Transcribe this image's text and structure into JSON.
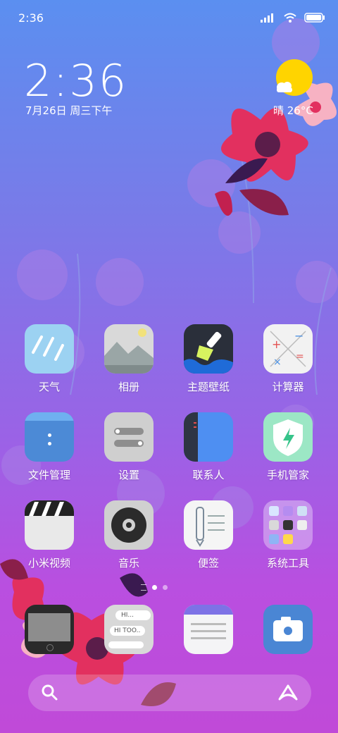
{
  "status_bar": {
    "time": "2:36"
  },
  "clock": {
    "time": "2:36",
    "date": "7月26日 周三下午"
  },
  "weather": {
    "text": "晴 26°C"
  },
  "apps_row1": [
    {
      "label": "天气",
      "icon": "weather-rain-icon"
    },
    {
      "label": "相册",
      "icon": "gallery-icon"
    },
    {
      "label": "主题壁纸",
      "icon": "theme-brush-icon"
    },
    {
      "label": "计算器",
      "icon": "calculator-icon"
    }
  ],
  "apps_row2": [
    {
      "label": "文件管理",
      "icon": "folder-icon"
    },
    {
      "label": "设置",
      "icon": "settings-toggle-icon"
    },
    {
      "label": "联系人",
      "icon": "contacts-book-icon"
    },
    {
      "label": "手机管家",
      "icon": "security-shield-icon"
    }
  ],
  "apps_row3": [
    {
      "label": "小米视频",
      "icon": "video-clapper-icon"
    },
    {
      "label": "音乐",
      "icon": "music-disc-icon"
    },
    {
      "label": "便签",
      "icon": "notes-pen-icon"
    },
    {
      "label": "系统工具",
      "icon": "folder-system-tools-icon"
    }
  ],
  "dock": [
    {
      "name": "phone",
      "icon": "phone-device-icon"
    },
    {
      "name": "messages",
      "icon": "chat-bubbles-icon",
      "bubble1": "HI...",
      "bubble2": "HI TOO.."
    },
    {
      "name": "browser",
      "icon": "browser-window-icon"
    },
    {
      "name": "camera",
      "icon": "camera-icon"
    }
  ],
  "page_indicator": {
    "pages": 2,
    "current": 1
  },
  "colors": {
    "bg_top": "#5b8ff0",
    "bg_bottom": "#c04ad8",
    "sun": "#ffd400"
  }
}
